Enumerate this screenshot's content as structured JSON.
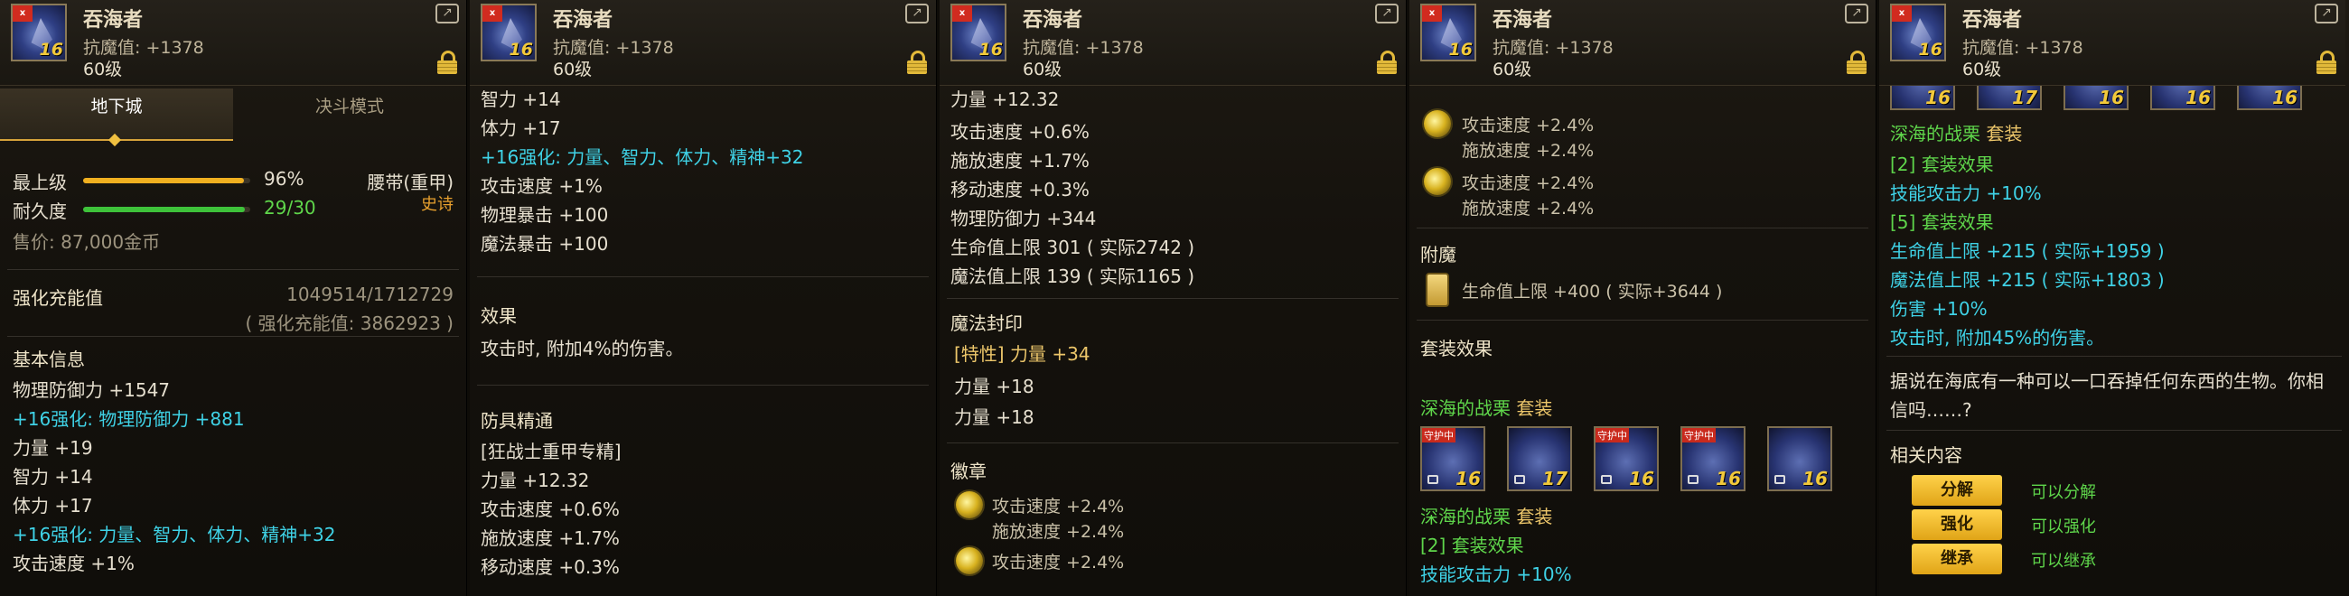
{
  "item": {
    "name": "吞海者",
    "resist": "抗魔值: +1378",
    "level": "60级",
    "enhance": "16",
    "thumb_tag": "x"
  },
  "p1": {
    "tabs": [
      "地下城",
      "决斗模式"
    ],
    "grade_label": "最上级",
    "grade_value": "96%",
    "grade_fraction": 0.96,
    "durability_label": "耐久度",
    "durability_value": "29/30",
    "durability_fraction": 0.967,
    "slot": "腰带(重甲)",
    "rarity": "史诗",
    "price": "售价: 87,000金币",
    "charge_label": "强化充能值",
    "charge_value": "1049514/1712729",
    "charge_total": "( 强化充能值: 3862923 )",
    "basic_title": "基本信息",
    "lines": [
      {
        "t": "物理防御力 +1547",
        "c": "w"
      },
      {
        "t": "+16强化: 物理防御力 +881",
        "c": "c"
      },
      {
        "t": "力量 +19",
        "c": "w"
      },
      {
        "t": "智力 +14",
        "c": "w"
      },
      {
        "t": "体力 +17",
        "c": "w"
      },
      {
        "t": "+16强化: 力量、智力、体力、精神+32",
        "c": "c"
      },
      {
        "t": "攻击速度 +1%",
        "c": "w"
      }
    ]
  },
  "p2": {
    "top": [
      {
        "t": "智力 +14",
        "c": "w"
      },
      {
        "t": "体力 +17",
        "c": "w"
      },
      {
        "t": "+16强化: 力量、智力、体力、精神+32",
        "c": "c"
      },
      {
        "t": "攻击速度 +1%",
        "c": "w"
      },
      {
        "t": "物理暴击 +100",
        "c": "w"
      },
      {
        "t": "魔法暴击 +100",
        "c": "w"
      }
    ],
    "effect_title": "效果",
    "effect_text": "攻击时, 附加4%的伤害。",
    "mastery_title": "防具精通",
    "mastery_lines": [
      {
        "t": "[狂战士重甲专精]",
        "c": "w"
      },
      {
        "t": "力量 +12.32",
        "c": "w"
      },
      {
        "t": "攻击速度 +0.6%",
        "c": "w"
      },
      {
        "t": "施放速度 +1.7%",
        "c": "w"
      },
      {
        "t": "移动速度 +0.3%",
        "c": "w"
      }
    ]
  },
  "p3": {
    "top": [
      {
        "t": "力量 +12.32",
        "c": "w"
      },
      {
        "t": "攻击速度 +0.6%",
        "c": "w"
      },
      {
        "t": "施放速度 +1.7%",
        "c": "w"
      },
      {
        "t": "移动速度 +0.3%",
        "c": "w"
      },
      {
        "t": "物理防御力 +344",
        "c": "w"
      },
      {
        "t": "生命值上限 301 ( 实际2742 )",
        "c": "w"
      },
      {
        "t": "魔法值上限 139 ( 实际1165 )",
        "c": "w"
      }
    ],
    "seal_title": "魔法封印",
    "seal_lines": [
      "[特性] 力量 +34",
      "力量 +18",
      "力量 +18"
    ],
    "emblem_title": "徽章",
    "emblem1": [
      "攻击速度 +2.4%",
      "施放速度 +2.4%"
    ],
    "emblem2": [
      "攻击速度 +2.4%"
    ]
  },
  "p4": {
    "emblem1": [
      "攻击速度 +2.4%",
      "施放速度 +2.4%"
    ],
    "emblem2": [
      "攻击速度 +2.4%",
      "施放速度 +2.4%"
    ],
    "enchant_title": "附魔",
    "enchant_text": "生命值上限 +400 ( 实际+3644 )",
    "set_title": "套装效果",
    "set_name": "深海的战栗",
    "set_tag": "套装",
    "set_items": [
      "16",
      "17",
      "16",
      "16",
      "16"
    ],
    "set_tags": [
      "守护中",
      "",
      "守护中",
      "守护中",
      ""
    ],
    "set_name2": "深海的战栗",
    "set_tag2": "套装",
    "set2_label": "[2] 套装效果",
    "set2_line": "技能攻击力 +10%"
  },
  "p5": {
    "strip": [
      "16",
      "17",
      "16",
      "16",
      "16"
    ],
    "set_name": "深海的战栗",
    "set_tag": "套装",
    "lines": [
      {
        "t": "[2] 套装效果",
        "c": "g"
      },
      {
        "t": "技能攻击力 +10%",
        "c": "c"
      },
      {
        "t": "[5] 套装效果",
        "c": "g"
      },
      {
        "t": "生命值上限 +215 ( 实际+1959 )",
        "c": "c"
      },
      {
        "t": "魔法值上限 +215 ( 实际+1803 )",
        "c": "c"
      },
      {
        "t": "伤害 +10%",
        "c": "c"
      },
      {
        "t": "攻击时, 附加45%的伤害。",
        "c": "c"
      }
    ],
    "desc1": "据说在海底有一种可以一口吞掉任何东西的生物。你相",
    "desc2": "信吗……?",
    "related_title": "相关内容",
    "actions": [
      {
        "btn": "分解",
        "label": "可以分解"
      },
      {
        "btn": "强化",
        "label": "可以强化"
      },
      {
        "btn": "继承",
        "label": "可以继承"
      }
    ]
  },
  "colors": {
    "cyan": "#3fd2e6",
    "green": "#5fd64b",
    "gold": "#ecc66a",
    "grade_bar": "#f0b020",
    "durability_bar": "#3ec23a"
  }
}
